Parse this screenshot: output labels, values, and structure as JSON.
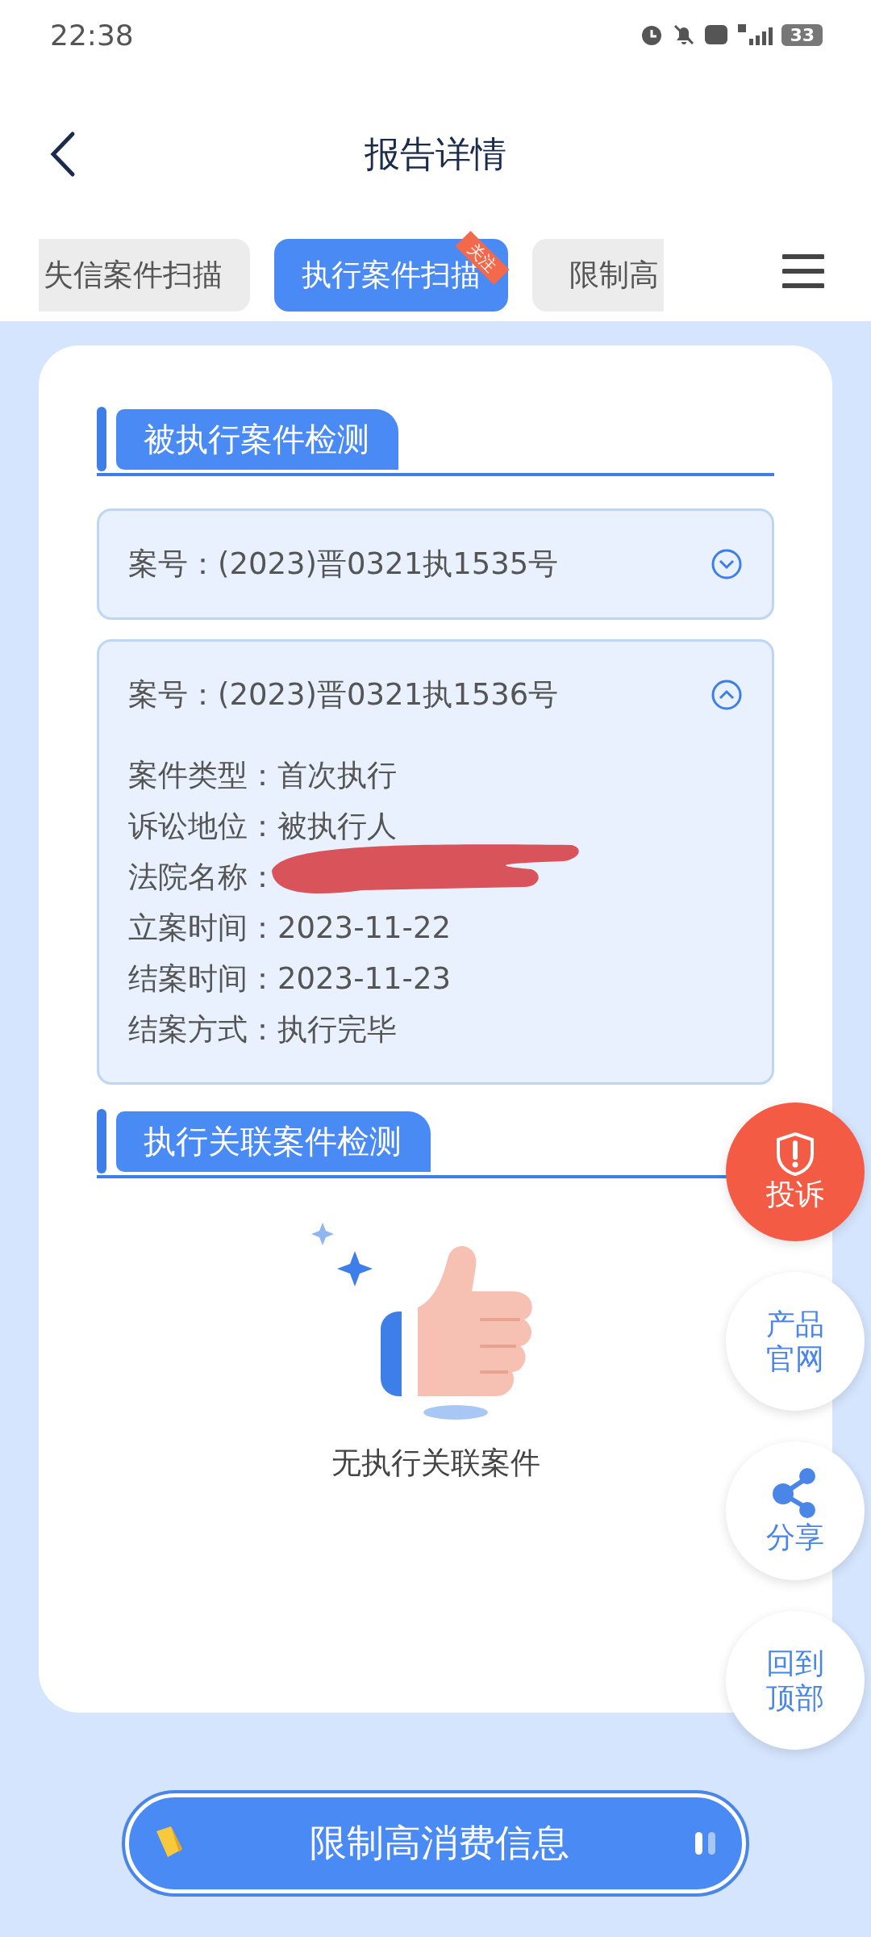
{
  "status_bar": {
    "time": "22:38",
    "battery": "33"
  },
  "header": {
    "title": "报告详情"
  },
  "tabs": [
    {
      "label": "失信案件扫描",
      "selected": false
    },
    {
      "label": "执行案件扫描",
      "selected": true,
      "badge": "关注"
    },
    {
      "label": "限制高",
      "selected": false
    }
  ],
  "sections": [
    {
      "title": "被执行案件检测",
      "cases": [
        {
          "case_no": "案号：(2023)晋0321执1535号",
          "expanded": false
        },
        {
          "case_no": "案号：(2023)晋0321执1536号",
          "expanded": true,
          "details": [
            {
              "kind": "text",
              "label": "案件类型：",
              "value": "首次执行"
            },
            {
              "kind": "text",
              "label": "诉讼地位：",
              "value": "被执行人"
            },
            {
              "kind": "redacted",
              "label": "法院名称："
            },
            {
              "kind": "text",
              "label": "立案时间：",
              "value": "2023-11-22"
            },
            {
              "kind": "text",
              "label": "结案时间：",
              "value": "2023-11-23"
            },
            {
              "kind": "text",
              "label": "结案方式：",
              "value": "执行完毕"
            }
          ]
        }
      ]
    },
    {
      "title": "执行关联案件检测",
      "empty_text": "无执行关联案件"
    }
  ],
  "float_buttons": [
    {
      "kind": "warning",
      "label": "投诉"
    },
    {
      "kind": "plain",
      "label": "产品官网"
    },
    {
      "kind": "share",
      "label": "分享"
    },
    {
      "kind": "plain",
      "label": "回到顶部"
    }
  ],
  "bottom_button": {
    "label": "限制高消费信息"
  }
}
